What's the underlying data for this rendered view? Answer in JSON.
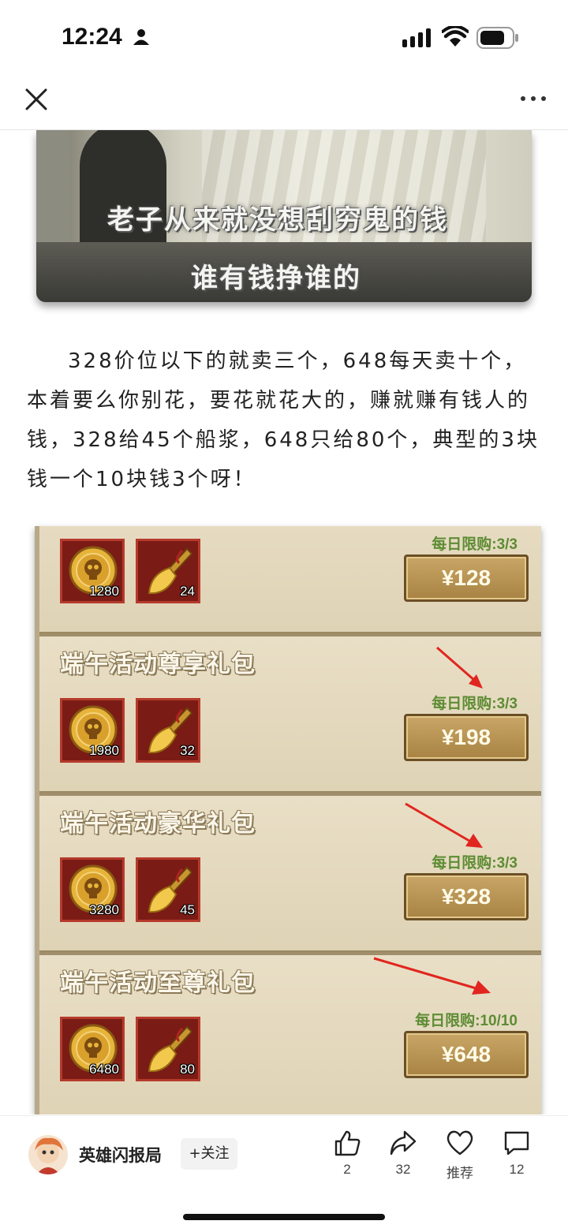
{
  "status_bar": {
    "time": "12:24"
  },
  "article": {
    "meme_caption_line1": "老子从来就没想刮穷鬼的钱",
    "meme_caption_line2": "谁有钱挣谁的",
    "paragraph": "328价位以下的就卖三个，648每天卖十个，本着要么你别花，要花就花大的，赚就赚有钱人的钱，328给45个船浆，648只给80个，典型的3块钱一个10块钱3个呀！"
  },
  "shop": {
    "packs": [
      {
        "title": "",
        "coin_count": "1280",
        "paddle_count": "24",
        "limit": "每日限购:3/3",
        "price": "¥128"
      },
      {
        "title": "端午活动尊享礼包",
        "coin_count": "1980",
        "paddle_count": "32",
        "limit": "每日限购:3/3",
        "price": "¥198"
      },
      {
        "title": "端午活动豪华礼包",
        "coin_count": "3280",
        "paddle_count": "45",
        "limit": "每日限购:3/3",
        "price": "¥328"
      },
      {
        "title": "端午活动至尊礼包",
        "coin_count": "6480",
        "paddle_count": "80",
        "limit": "每日限购:10/10",
        "price": "¥648"
      }
    ]
  },
  "bottom_bar": {
    "author": "英雄闪报局",
    "follow_label": "+关注",
    "like_count": "2",
    "share_count": "32",
    "recommend_label": "推荐",
    "comment_count": "12"
  },
  "colors": {
    "limit_green": "#5e8c34",
    "arrow_red": "#e0261f",
    "gold": "#c9a667"
  }
}
